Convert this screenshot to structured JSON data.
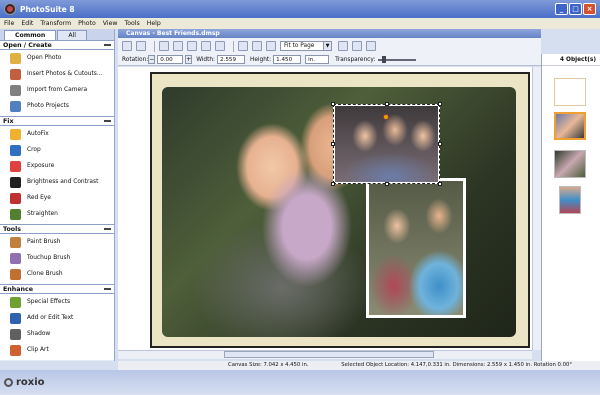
{
  "window": {
    "title": "PhotoSuite 8",
    "minimize_label": "_",
    "maximize_label": "□",
    "close_label": "×"
  },
  "menu": [
    "File",
    "Edit",
    "Transform",
    "Photo",
    "View",
    "Tools",
    "Help"
  ],
  "left": {
    "tabs": [
      "Common",
      "All"
    ],
    "sections": [
      {
        "title": "Open / Create",
        "items": [
          {
            "label": "Open Photo",
            "icon": "folder-icon",
            "color": "#e0b040"
          },
          {
            "label": "Insert Photos & Cutouts...",
            "icon": "insert-photo-icon",
            "color": "#c06040"
          },
          {
            "label": "Import from Camera",
            "icon": "camera-icon",
            "color": "#808080"
          },
          {
            "label": "Photo Projects",
            "icon": "projects-icon",
            "color": "#5080c0"
          }
        ]
      },
      {
        "title": "Fix",
        "items": [
          {
            "label": "AutoFix",
            "icon": "autofix-icon",
            "color": "#f0b030"
          },
          {
            "label": "Crop",
            "icon": "crop-icon",
            "color": "#3070c0"
          },
          {
            "label": "Exposure",
            "icon": "exposure-icon",
            "color": "#e04040"
          },
          {
            "label": "Brightness and Contrast",
            "icon": "brightness-icon",
            "color": "#202020"
          },
          {
            "label": "Red Eye",
            "icon": "red-eye-icon",
            "color": "#c03030"
          },
          {
            "label": "Straighten",
            "icon": "straighten-icon",
            "color": "#508030"
          }
        ]
      },
      {
        "title": "Tools",
        "items": [
          {
            "label": "Paint Brush",
            "icon": "paint-brush-icon",
            "color": "#c08040"
          },
          {
            "label": "Touchup Brush",
            "icon": "touchup-brush-icon",
            "color": "#9070b0"
          },
          {
            "label": "Clone Brush",
            "icon": "clone-brush-icon",
            "color": "#c07030"
          }
        ]
      },
      {
        "title": "Enhance",
        "items": [
          {
            "label": "Special Effects",
            "icon": "special-effects-icon",
            "color": "#70a030"
          },
          {
            "label": "Add or Edit Text",
            "icon": "text-icon",
            "color": "#3060b0"
          },
          {
            "label": "Shadow",
            "icon": "shadow-icon",
            "color": "#606060"
          },
          {
            "label": "Clip Art",
            "icon": "clip-art-icon",
            "color": "#d06030"
          }
        ]
      }
    ]
  },
  "canvas_title": "Canvas - Best Friends.dmsp",
  "toolbar": {
    "zoom": "Fit to Page"
  },
  "props": {
    "rotation_label": "Rotation:",
    "rotation": "0.00",
    "width_label": "Width:",
    "width": "2.559",
    "height_label": "Height:",
    "height": "1.450",
    "unit": "in.",
    "transparency_label": "Transparency:"
  },
  "objects": {
    "count_label": "4 Object(s)"
  },
  "status": {
    "canvas_size": "Canvas Size: 7.042 x 4.450 in.",
    "selection": "Selected Object Location: 4.147,0.331 in. Dimensions: 2.559 x 1.450 in. Rotation 0.00°"
  },
  "brand": "roxio"
}
